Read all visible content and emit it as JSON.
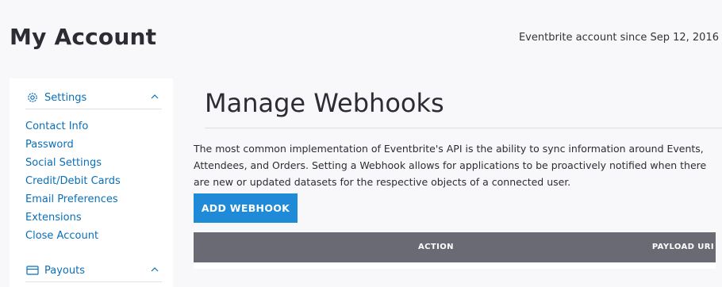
{
  "header": {
    "title": "My Account",
    "account_since": "Eventbrite account since Sep 12, 2016"
  },
  "sidebar": {
    "settings": {
      "label": "Settings",
      "icon": "gear-icon",
      "expanded": true,
      "items": [
        {
          "label": "Contact Info"
        },
        {
          "label": "Password"
        },
        {
          "label": "Social Settings"
        },
        {
          "label": "Credit/Debit Cards"
        },
        {
          "label": "Email Preferences"
        },
        {
          "label": "Extensions"
        },
        {
          "label": "Close Account"
        }
      ]
    },
    "payouts": {
      "label": "Payouts",
      "icon": "card-icon",
      "expanded": true
    }
  },
  "main": {
    "title": "Manage Webhooks",
    "description": "The most common implementation of Eventbrite's API is the ability to sync information around Events, Attendees, and Orders. Setting a Webhook allows for applications to be proactively notified when there are new or updated datasets for the respective objects of a connected user.",
    "add_button_label": "ADD WEBHOOK",
    "table": {
      "columns": [
        "ACTION",
        "PAYLOAD URI"
      ]
    }
  },
  "colors": {
    "link": "#0a6fb8",
    "primary_button": "#1f8ad8",
    "table_header": "#696a74",
    "background": "#f8f8fa"
  }
}
